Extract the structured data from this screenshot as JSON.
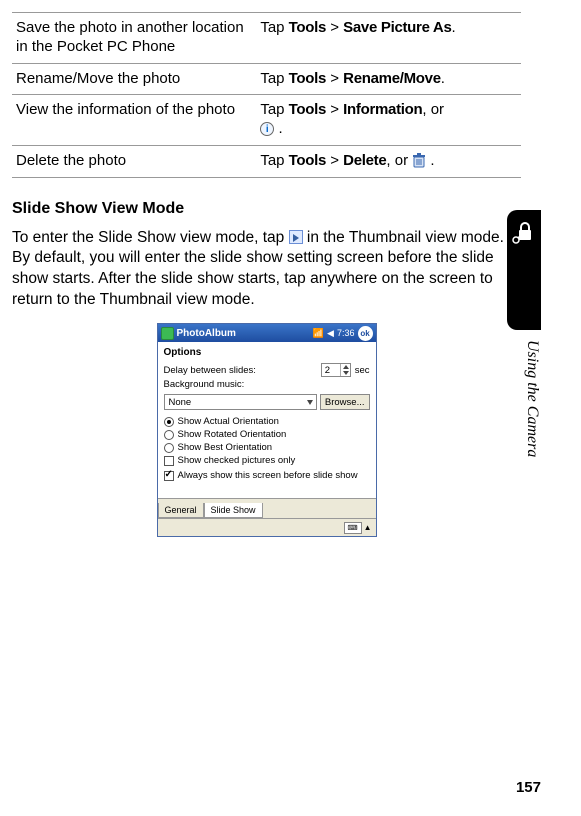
{
  "table": {
    "rows": [
      {
        "task": "Save the photo in another location in the Pocket PC Phone",
        "action_pre": "Tap ",
        "tools": "Tools",
        "gt": " > ",
        "cmd": "Save Picture As",
        "tail": "."
      },
      {
        "task": "Rename/Move the photo",
        "action_pre": "Tap ",
        "tools": "Tools",
        "gt": " > ",
        "cmd": "Rename/Move",
        "tail": "."
      },
      {
        "task": "View the information of the photo",
        "action_pre": "Tap ",
        "tools": "Tools",
        "gt": " > ",
        "cmd": "Information",
        "tail": ", or ",
        "icon": "info"
      },
      {
        "task": "Delete the photo",
        "action_pre": "Tap ",
        "tools": "Tools",
        "gt": " > ",
        "cmd": "Delete",
        "tail": ", or ",
        "icon": "trash"
      }
    ]
  },
  "section_heading": "Slide Show View Mode",
  "paragraph_pre": "To enter the Slide Show view mode, tap ",
  "paragraph_post": " in the Thumbnail view mode. By default, you will enter the slide show setting screen before the slide show starts. After the slide show starts, tap anywhere on the screen to return to the Thumbnail view mode.",
  "side_label": "Using the Camera",
  "page_number": "157",
  "pda": {
    "title": "PhotoAlbum",
    "time": "7:36",
    "options_heading": "Options",
    "delay_label": "Delay between slides:",
    "delay_value": "2",
    "delay_unit": "sec",
    "bg_label": "Background music:",
    "bg_value": "None",
    "browse": "Browse...",
    "radios": [
      {
        "label": "Show Actual Orientation",
        "checked": true
      },
      {
        "label": "Show Rotated Orientation",
        "checked": false
      },
      {
        "label": "Show Best Orientation",
        "checked": false
      }
    ],
    "checks": [
      {
        "label": "Show checked pictures only",
        "checked": false
      },
      {
        "label": "Always show this screen before slide show",
        "checked": true
      }
    ],
    "tabs": [
      "General",
      "Slide Show"
    ]
  }
}
